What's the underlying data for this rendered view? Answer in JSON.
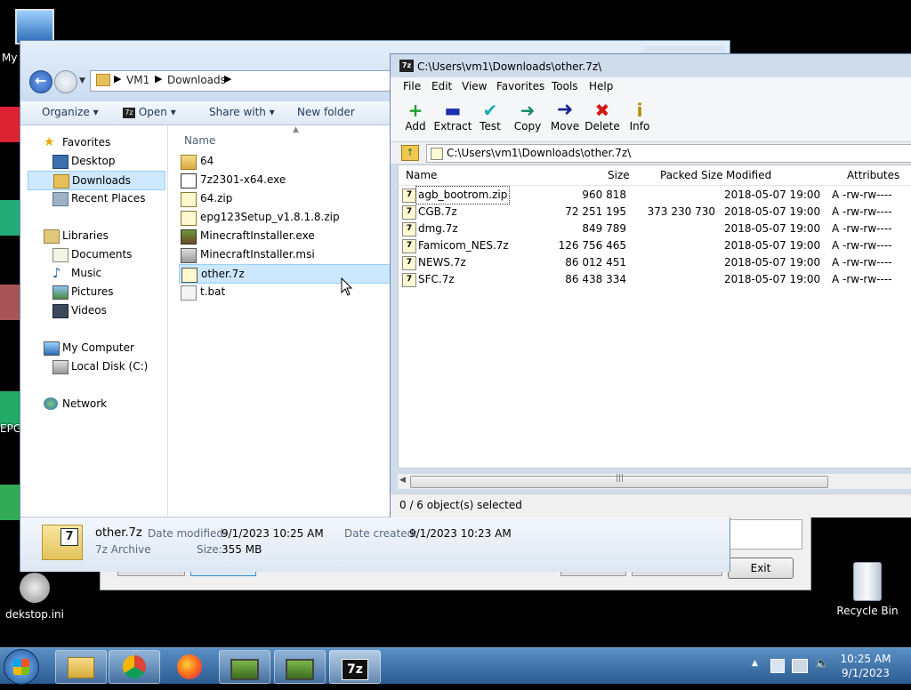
{
  "desktop": {
    "my_computer_label": "My",
    "epg_label": "EPG",
    "desktop_ini_label": "dekstop.ini",
    "recycle_bin_label": "Recycle Bin"
  },
  "background_dialog": {
    "exit_label": "Exit"
  },
  "explorer": {
    "breadcrumb": [
      "VM1",
      "Downloads"
    ],
    "toolbar": {
      "organize": "Organize",
      "open": "Open",
      "share_with": "Share with",
      "new_folder": "New folder"
    },
    "nav": {
      "favorites": "Favorites",
      "desktop": "Desktop",
      "downloads": "Downloads",
      "recent_places": "Recent Places",
      "libraries": "Libraries",
      "documents": "Documents",
      "music": "Music",
      "pictures": "Pictures",
      "videos": "Videos",
      "my_computer": "My Computer",
      "local_disk": "Local Disk (C:)",
      "network": "Network"
    },
    "column_name": "Name",
    "files": [
      {
        "name": "64",
        "icon": "folder-icon"
      },
      {
        "name": "7z2301-x64.exe",
        "icon": "7z-exe-icon"
      },
      {
        "name": "64.zip",
        "icon": "zip-icon"
      },
      {
        "name": "epg123Setup_v1.8.1.8.zip",
        "icon": "zip-icon"
      },
      {
        "name": "MinecraftInstaller.exe",
        "icon": "minecraft-icon"
      },
      {
        "name": "MinecraftInstaller.msi",
        "icon": "msi-icon"
      },
      {
        "name": "other.7z",
        "icon": "7z-archive-icon"
      },
      {
        "name": "t.bat",
        "icon": "bat-icon"
      }
    ],
    "details": {
      "name": "other.7z",
      "type": "7z Archive",
      "date_modified_label": "Date modified:",
      "date_modified": "9/1/2023 10:25 AM",
      "date_created_label": "Date created:",
      "date_created": "9/1/2023 10:23 AM",
      "size_label": "Size:",
      "size": "355 MB"
    }
  },
  "szip": {
    "title": "C:\\Users\\vm1\\Downloads\\other.7z\\",
    "menu": [
      "File",
      "Edit",
      "View",
      "Favorites",
      "Tools",
      "Help"
    ],
    "tools": [
      {
        "label": "Add",
        "icon": "add-icon",
        "glyph": "+",
        "color": "#1e9e2a"
      },
      {
        "label": "Extract",
        "icon": "extract-icon",
        "glyph": "▬",
        "color": "#1b2fb0"
      },
      {
        "label": "Test",
        "icon": "test-icon",
        "glyph": "✔",
        "color": "#18a9b4"
      },
      {
        "label": "Copy",
        "icon": "copy-icon",
        "glyph": "➜",
        "color": "#1d8a6a"
      },
      {
        "label": "Move",
        "icon": "move-icon",
        "glyph": "➜",
        "color": "#1b2590"
      },
      {
        "label": "Delete",
        "icon": "delete-icon",
        "glyph": "✖",
        "color": "#d21a1a"
      },
      {
        "label": "Info",
        "icon": "info-icon",
        "glyph": "i",
        "color": "#b48a00"
      }
    ],
    "path": "C:\\Users\\vm1\\Downloads\\other.7z\\",
    "columns": {
      "name": "Name",
      "size": "Size",
      "packed": "Packed Size",
      "modified": "Modified",
      "attributes": "Attributes"
    },
    "rows": [
      {
        "name": "agb_bootrom.zip",
        "size": "960 818",
        "packed": "",
        "modified": "2018-05-07 19:00",
        "attr": "A -rw-rw----"
      },
      {
        "name": "CGB.7z",
        "size": "72 251 195",
        "packed": "373 230 730",
        "modified": "2018-05-07 19:00",
        "attr": "A -rw-rw----"
      },
      {
        "name": "dmg.7z",
        "size": "849 789",
        "packed": "",
        "modified": "2018-05-07 19:00",
        "attr": "A -rw-rw----"
      },
      {
        "name": "Famicom_NES.7z",
        "size": "126 756 465",
        "packed": "",
        "modified": "2018-05-07 19:00",
        "attr": "A -rw-rw----"
      },
      {
        "name": "NEWS.7z",
        "size": "86 012 451",
        "packed": "",
        "modified": "2018-05-07 19:00",
        "attr": "A -rw-rw----"
      },
      {
        "name": "SFC.7z",
        "size": "86 438 334",
        "packed": "",
        "modified": "2018-05-07 19:00",
        "attr": "A -rw-rw----"
      }
    ],
    "status": "0 / 6 object(s) selected"
  },
  "taskbar": {
    "time": "10:25 AM",
    "date": "9/1/2023",
    "apps": [
      "file-explorer-icon",
      "chrome-icon",
      "firefox-icon",
      "tv-app-icon",
      "tv-app-icon",
      "7zip-icon"
    ],
    "sevenzip_label": "7z"
  }
}
